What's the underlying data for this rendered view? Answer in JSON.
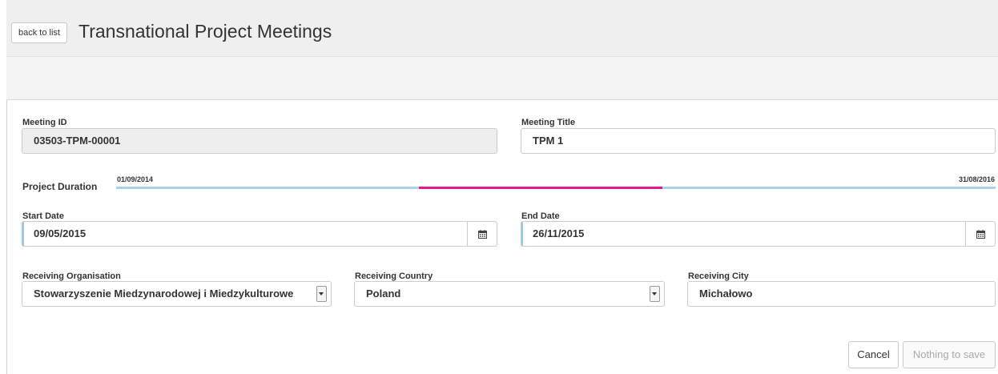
{
  "header": {
    "back_label": "back to list",
    "title": "Transnational Project Meetings"
  },
  "meeting_id": {
    "label": "Meeting ID",
    "value": "03503-TPM-00001"
  },
  "meeting_title": {
    "label": "Meeting Title",
    "value": "TPM 1"
  },
  "duration": {
    "label": "Project Duration",
    "start": "01/09/2014",
    "end": "31/08/2016",
    "meeting_start_fraction": 0.344,
    "meeting_end_fraction": 0.621,
    "track_color": "#a9d2e8",
    "meeting_color": "#e6168c"
  },
  "start_date": {
    "label": "Start Date",
    "value": "09/05/2015",
    "icon": "calendar-icon"
  },
  "end_date": {
    "label": "End Date",
    "value": "26/11/2015",
    "icon": "calendar-icon"
  },
  "receiving_organisation": {
    "label": "Receiving Organisation",
    "value": "Stowarzyszenie Miedzynarodowej i Miedzykulturowe"
  },
  "receiving_country": {
    "label": "Receiving Country",
    "value": "Poland"
  },
  "receiving_city": {
    "label": "Receiving City",
    "value": "Michałowo"
  },
  "actions": {
    "cancel": "Cancel",
    "save": "Nothing to save"
  }
}
